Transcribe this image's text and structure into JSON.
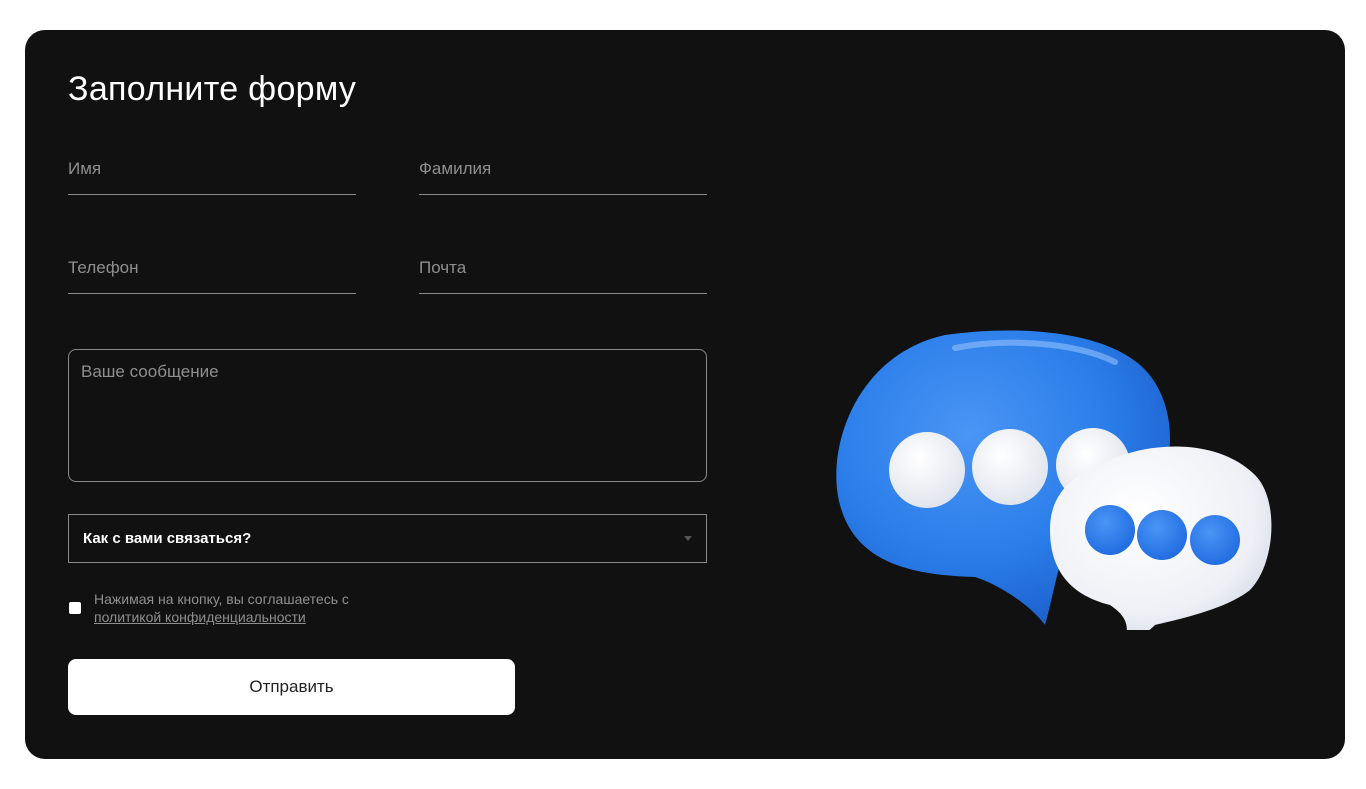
{
  "form": {
    "title": "Заполните форму",
    "fields": {
      "first_name_placeholder": "Имя",
      "last_name_placeholder": "Фамилия",
      "phone_placeholder": "Телефон",
      "email_placeholder": "Почта",
      "message_placeholder": "Ваше сообщение"
    },
    "contact_method": {
      "label": "Как с вами связаться?"
    },
    "consent": {
      "text": "Нажимая на кнопку, вы соглашаетесь с",
      "link_text": "политикой конфиденциальности",
      "checked": false
    },
    "submit_label": "Отправить"
  },
  "illustration": {
    "icon": "chat-bubbles-icon",
    "colors": {
      "blue_bubble": "#2a7de9",
      "white_bubble": "#f1f3f8",
      "dots_blue": "#2a7de9",
      "dots_white": "#e9ecf4"
    }
  },
  "colors": {
    "page_background": "#ffffff",
    "card_background": "#111111",
    "text_primary": "#ffffff",
    "text_muted": "#8f8f8f",
    "border": "#8a8a8a",
    "button_background": "#ffffff"
  }
}
